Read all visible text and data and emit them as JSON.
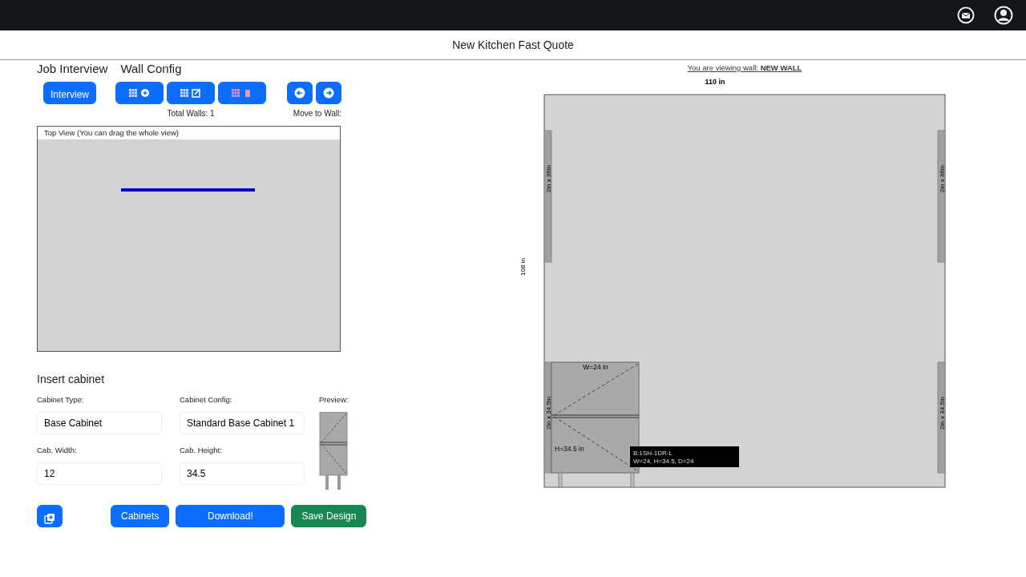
{
  "app_title": "New Kitchen Fast Quote",
  "section_links": [
    "Job Interview",
    "Wall Config"
  ],
  "interview_button": "Interview",
  "wall_buttons": [
    {
      "kind": "add"
    },
    {
      "kind": "edit"
    },
    {
      "kind": "delete"
    }
  ],
  "total_walls": "Total Walls: 1",
  "nav_buttons": [
    {
      "kind": "prev"
    },
    {
      "kind": "next"
    }
  ],
  "move_label": "Move to Wall:",
  "top_view": {
    "title": "Top View (You can drag the whole view)"
  },
  "insert": {
    "heading": "Insert cabinet",
    "fields": [
      {
        "label": "Cabinet Type:",
        "value": "Base Cabinet",
        "kind": "select"
      },
      {
        "label": "Cabinet Config:",
        "value": "Standard Base Cabinet 1",
        "kind": "select"
      },
      {
        "label": "Cab. Width:",
        "value": "12",
        "kind": "number"
      },
      {
        "label": "Cab. Height:",
        "value": "34.5",
        "kind": "number"
      }
    ],
    "preview_label": "Preview:"
  },
  "actions": [
    {
      "label": "Cabinets",
      "kind": "primary"
    },
    {
      "label": "Download!",
      "kind": "primary"
    },
    {
      "label": "Save Design",
      "kind": "success"
    }
  ],
  "wall_view": {
    "viewing_label": "You are viewing wall:",
    "wall_name": "NEW WALL",
    "width_label": "110 in",
    "height_label": "108 in",
    "upper_fillers": [
      "2in x 36in",
      "2in x 36in"
    ],
    "lower_fillers": [
      "2in x 34.5in",
      "2in x 34.5in"
    ],
    "cabinet": {
      "width_label": "W=24 in",
      "height_label": "H=34.5 in"
    },
    "tooltip": [
      "B:1SH-1DR-L",
      "W=24, H=34.5, D=24"
    ]
  }
}
